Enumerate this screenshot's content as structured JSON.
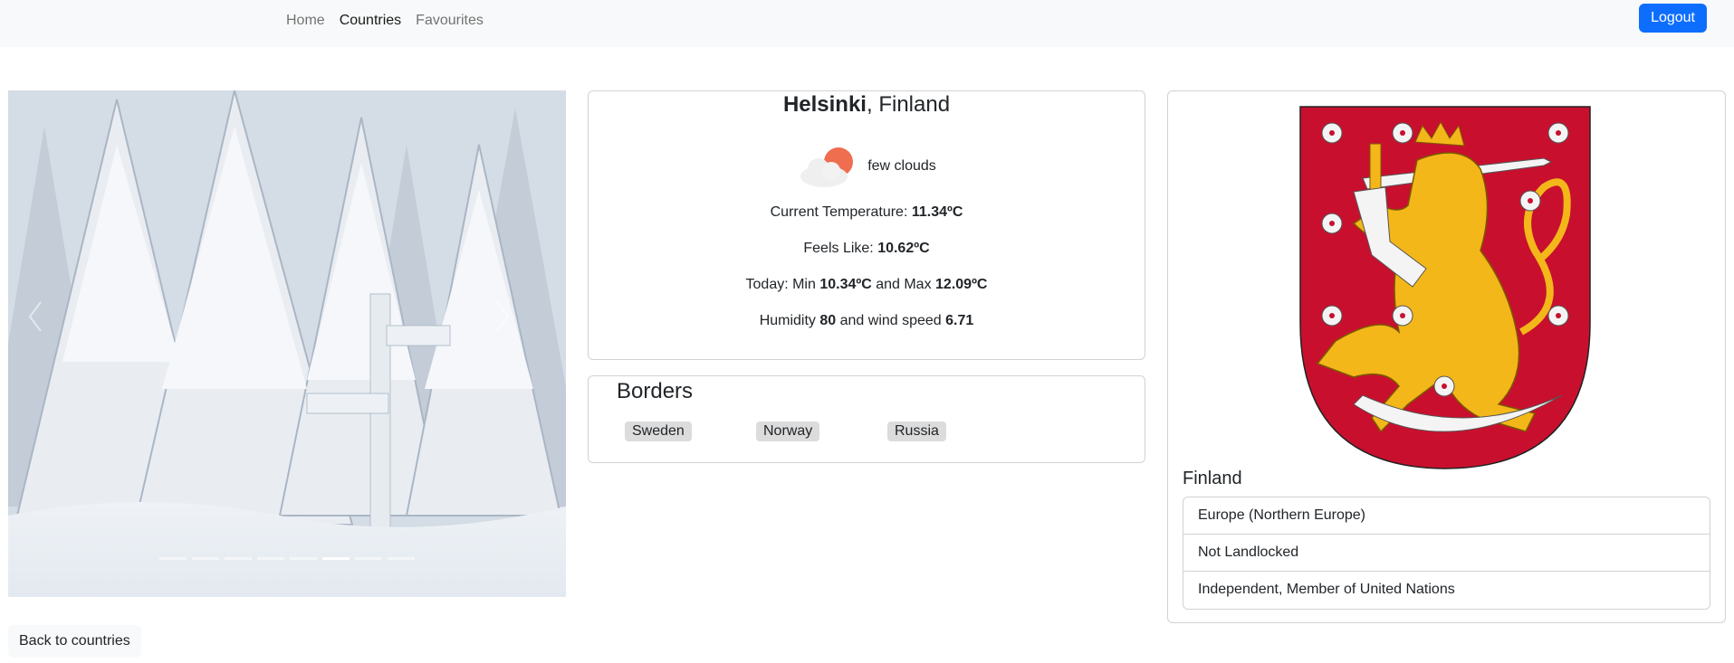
{
  "nav": {
    "links": [
      {
        "label": "Home",
        "active": false
      },
      {
        "label": "Countries",
        "active": true
      },
      {
        "label": "Favourites",
        "active": false
      }
    ],
    "logout_label": "Logout"
  },
  "carousel": {
    "slide_count": 8,
    "active_index": 5,
    "prev_icon": "chevron-left-icon",
    "next_icon": "chevron-right-icon"
  },
  "weather": {
    "city": "Helsinki",
    "country_suffix": ", Finland",
    "icon": "few-clouds-icon",
    "description": "few clouds",
    "temp_label": "Current Temperature: ",
    "temp_value": "11.34ºC",
    "feels_label": "Feels Like: ",
    "feels_value": "10.62ºC",
    "today_label": "Today: Min ",
    "min_value": "10.34ºC",
    "and_max_label": " and Max ",
    "max_value": "12.09ºC",
    "humidity_label": "Humidity ",
    "humidity_value": "80",
    "wind_label": " and wind speed ",
    "wind_value": "6.71"
  },
  "borders": {
    "title": "Borders",
    "countries": [
      "Sweden",
      "Norway",
      "Russia"
    ]
  },
  "country": {
    "name": "Finland",
    "info": [
      "Europe (Northern Europe)",
      "Not Landlocked",
      "Independent, Member of United Nations"
    ],
    "colors": {
      "shield_red": "#c8102e",
      "lion_gold": "#f4b71a"
    }
  },
  "back_label": "Back to countries",
  "colors": {
    "primary": "#0d6efd",
    "navbar_bg": "#f8f9fa"
  }
}
